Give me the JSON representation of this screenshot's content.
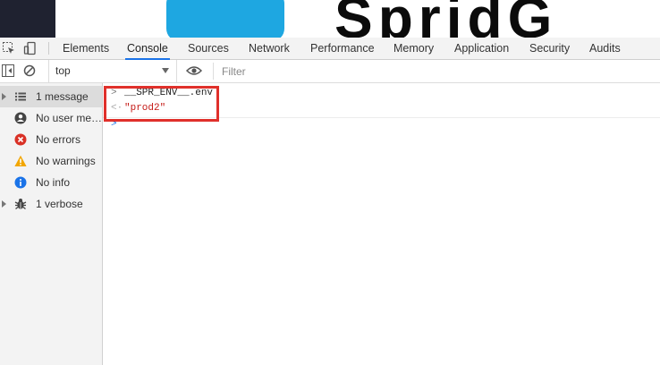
{
  "devtools": {
    "tabs": [
      "Elements",
      "Console",
      "Sources",
      "Network",
      "Performance",
      "Memory",
      "Application",
      "Security",
      "Audits"
    ],
    "active_tab": "Console"
  },
  "toolbar": {
    "context": "top",
    "filter_placeholder": "Filter"
  },
  "sidebar": {
    "items": [
      {
        "label": "1 message",
        "icon": "list-icon"
      },
      {
        "label": "No user me…",
        "icon": "user-icon"
      },
      {
        "label": "No errors",
        "icon": "error-icon"
      },
      {
        "label": "No warnings",
        "icon": "warning-icon"
      },
      {
        "label": "No info",
        "icon": "info-icon"
      },
      {
        "label": "1 verbose",
        "icon": "bug-icon"
      }
    ]
  },
  "console": {
    "input_expression": "__SPR_ENV__.env",
    "result_value": "\"prod2\""
  },
  "colors": {
    "accent": "#1a73e8",
    "highlight_border": "#e0302b",
    "string_value": "#c41a16",
    "error": "#d93025",
    "warning": "#f2a600",
    "info": "#1a73e8"
  }
}
